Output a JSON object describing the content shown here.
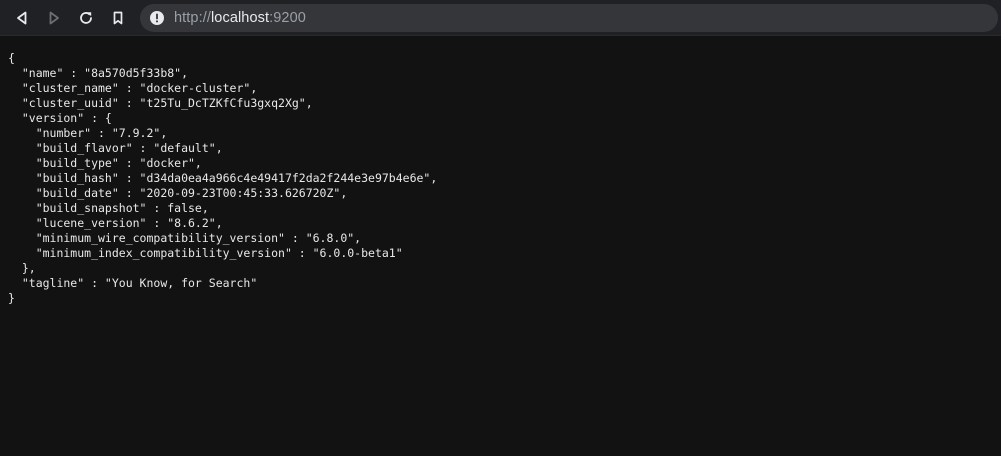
{
  "browser": {
    "url": {
      "scheme": "http://",
      "host": "localhost",
      "port": ":9200"
    },
    "icons": {
      "back": "back-arrow-icon",
      "forward": "forward-arrow-icon",
      "reload": "reload-icon",
      "bookmark": "bookmark-icon",
      "site_info": "info-icon"
    },
    "colors": {
      "toolbar": "#202124",
      "omnibox": "#35363a",
      "page_background": "#121212",
      "text": "#e8e8e8"
    }
  },
  "json_lines": [
    "{",
    "  \"name\" : \"8a570d5f33b8\",",
    "  \"cluster_name\" : \"docker-cluster\",",
    "  \"cluster_uuid\" : \"t25Tu_DcTZKfCfu3gxq2Xg\",",
    "  \"version\" : {",
    "    \"number\" : \"7.9.2\",",
    "    \"build_flavor\" : \"default\",",
    "    \"build_type\" : \"docker\",",
    "    \"build_hash\" : \"d34da0ea4a966c4e49417f2da2f244e3e97b4e6e\",",
    "    \"build_date\" : \"2020-09-23T00:45:33.626720Z\",",
    "    \"build_snapshot\" : false,",
    "    \"lucene_version\" : \"8.6.2\",",
    "    \"minimum_wire_compatibility_version\" : \"6.8.0\",",
    "    \"minimum_index_compatibility_version\" : \"6.0.0-beta1\"",
    "  },",
    "  \"tagline\" : \"You Know, for Search\"",
    "}"
  ]
}
